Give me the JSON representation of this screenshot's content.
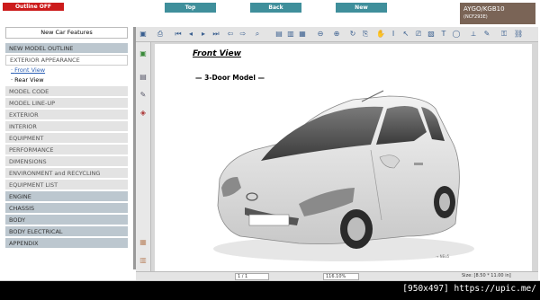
{
  "header": {
    "outline_button": "Outline OFF",
    "nav_buttons": [
      "Top",
      "Back",
      "New"
    ],
    "model_code": "AYGO/KGB10",
    "model_sub": "(NCF293E)"
  },
  "sidebar": {
    "title": "New Car Features",
    "section1": "NEW MODEL OUTLINE",
    "section1_items": [
      "EXTERIOR APPEARANCE"
    ],
    "sub_items": [
      "Front View",
      "Rear View"
    ],
    "section1_rest": [
      "MODEL CODE",
      "MODEL LINE-UP",
      "EXTERIOR",
      "INTERIOR",
      "EQUIPMENT",
      "PERFORMANCE",
      "DIMENSIONS",
      "ENVIRONMENT and RECYCLING",
      "EQUIPMENT LIST"
    ],
    "sections": [
      "ENGINE",
      "CHASSIS",
      "BODY",
      "BODY ELECTRICAL",
      "APPENDIX"
    ]
  },
  "document": {
    "title": "Front View",
    "model_label": "— 3-Door Model —",
    "watermark": "→ NEu5"
  },
  "statusbar": {
    "page": "1 / 1",
    "zoom": "116.10%",
    "size": "Size: [8.50 * 11.00 in]"
  },
  "footer": {
    "credit": "[950x497] https://upic.me/"
  }
}
